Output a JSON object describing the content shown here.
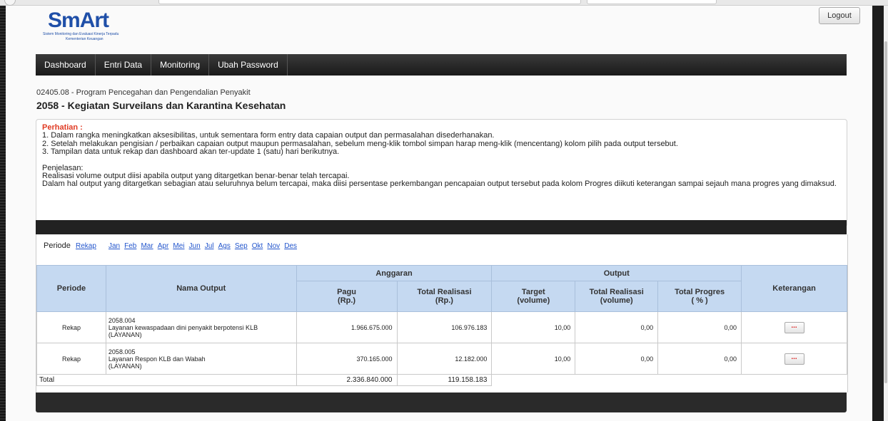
{
  "logo": {
    "word_sm": "Sm",
    "word_art": "Art",
    "tagline1": "Sistem Monitoring dan Evaluasi Kinerja Terpadu",
    "tagline2": "Kementerian Keuangan"
  },
  "header": {
    "logout_label": "Logout"
  },
  "nav": {
    "items": [
      "Dashboard",
      "Entri Data",
      "Monitoring",
      "Ubah Password"
    ]
  },
  "breadcrumb": "02405.08 - Program Pencegahan dan Pengendalian Penyakit",
  "page_title": "2058 - Kegiatan Surveilans dan Karantina Kesehatan",
  "notice": {
    "heading": "Perhatian :",
    "lines": [
      "1. Dalam rangka meningkatkan aksesibilitas, untuk sementara form entry data capaian output dan permasalahan disederhanakan.",
      "2. Setelah melakukan pengisian / perbaikan capaian output maupun permasalahan, sebelum meng-klik tombol simpan harap meng-klik (mencentang) kolom pilih pada output tersebut.",
      "3. Tampilan data untuk rekap dan dashboard akan ter-update 1 (satu) hari berikutnya."
    ],
    "penjelasan_heading": "Penjelasan:",
    "penjelasan_lines": [
      "Realisasi volume output diisi apabila output yang ditargetkan benar-benar telah tercapai.",
      "Dalam hal output yang ditargetkan sebagian atau seluruhnya belum tercapai, maka diisi persentase perkembangan pencapaian output tersebut pada kolom Progres diikuti keterangan sampai sejauh mana progres yang dimaksud."
    ]
  },
  "periode": {
    "label": "Periode",
    "rekap": "Rekap",
    "months": [
      "Jan",
      "Feb",
      "Mar",
      "Apr",
      "Mei",
      "Jun",
      "Jul",
      "Ags",
      "Sep",
      "Okt",
      "Nov",
      "Des"
    ]
  },
  "table": {
    "h_periode": "Periode",
    "h_nama": "Nama Output",
    "h_anggaran": "Anggaran",
    "h_output": "Output",
    "h_keterangan": "Keterangan",
    "h_pagu": "Pagu",
    "h_pagu_unit": "(Rp.)",
    "h_total_realisasi": "Total Realisasi",
    "h_total_realisasi_unit": "(Rp.)",
    "h_target": "Target",
    "h_target_unit": "(volume)",
    "h_realisasi_vol": "Total Realisasi",
    "h_realisasi_vol_unit": "(volume)",
    "h_progres": "Total Progres",
    "h_progres_unit": "( % )",
    "rows": [
      {
        "periode": "Rekap",
        "code": "2058.004",
        "name": "Layanan kewaspadaan dini penyakit berpotensi KLB",
        "type": "(LAYANAN)",
        "pagu": "1.966.675.000",
        "realisasi": "106.976.183",
        "target": "10,00",
        "realisasi_vol": "0,00",
        "progres": "0,00",
        "ket": "..."
      },
      {
        "periode": "Rekap",
        "code": "2058.005",
        "name": "Layanan Respon KLB dan Wabah",
        "type": "(LAYANAN)",
        "pagu": "370.165.000",
        "realisasi": "12.182.000",
        "target": "10,00",
        "realisasi_vol": "0,00",
        "progres": "0,00",
        "ket": "..."
      }
    ],
    "total_label": "Total",
    "total_pagu": "2.336.840.000",
    "total_realisasi": "119.158.183"
  },
  "colors": {
    "nav_bg": "#1a1a1a",
    "header_blue": "#c5d9f1",
    "warn": "#e03b24",
    "link": "#2255cc",
    "logo": "#1f4fa8"
  }
}
